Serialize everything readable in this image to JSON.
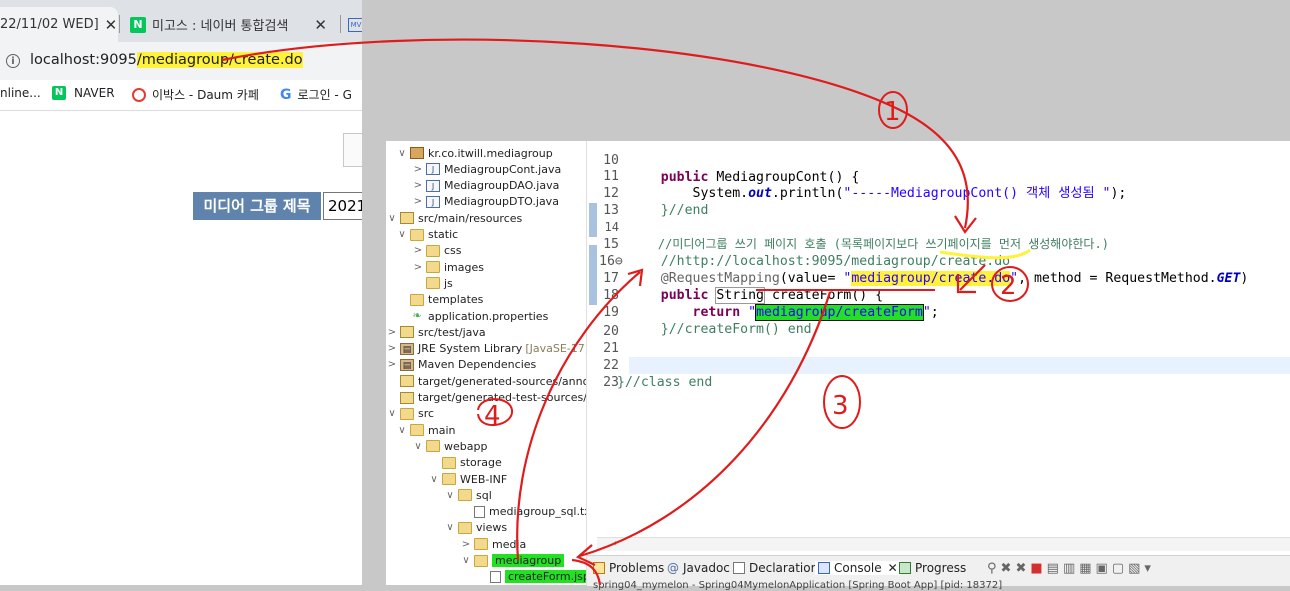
{
  "browser": {
    "tabs": [
      {
        "label": "22/11/02 WED] ",
        "close": "✕"
      },
      {
        "label": "미고스 : 네이버 통합검색",
        "close": "✕",
        "favicon": "N"
      },
      {
        "label": "MV",
        "favicon": "MV"
      }
    ],
    "url_host": "localhost:9095",
    "url_path": "/mediagroup/create.do",
    "bookmarks": [
      {
        "label": "nline..."
      },
      {
        "label": "NAVER",
        "icon": "N"
      },
      {
        "label": "이박스 - Daum 카페"
      },
      {
        "label": "로그인 - G",
        "icon": "G"
      }
    ],
    "form": {
      "title_label": "미디어 그룹 제목",
      "title_value": "2021"
    }
  },
  "explorer": {
    "items": [
      {
        "label": "kr.co.itwill.mediagroup",
        "twisty": "∨",
        "icon": "pkg"
      },
      {
        "label": "MediagroupCont.java",
        "twisty": ">",
        "icon": "java"
      },
      {
        "label": "MediagroupDAO.java",
        "twisty": ">",
        "icon": "java"
      },
      {
        "label": "MediagroupDTO.java",
        "twisty": ">",
        "icon": "java"
      },
      {
        "label": "src/main/resources",
        "twisty": "∨",
        "icon": "srcfolder"
      },
      {
        "label": "static",
        "twisty": "∨",
        "icon": "folder"
      },
      {
        "label": "css",
        "twisty": ">",
        "icon": "folder"
      },
      {
        "label": "images",
        "twisty": ">",
        "icon": "folder"
      },
      {
        "label": "js",
        "twisty": "",
        "icon": "folder"
      },
      {
        "label": "templates",
        "twisty": "",
        "icon": "folder"
      },
      {
        "label": "application.properties",
        "twisty": "",
        "icon": "leaf"
      },
      {
        "label": "src/test/java",
        "twisty": ">",
        "icon": "srcfolder"
      },
      {
        "label": "JRE System Library",
        "suffix": "[JavaSE-17]",
        "twisty": ">",
        "icon": "lib"
      },
      {
        "label": "Maven Dependencies",
        "twisty": ">",
        "icon": "lib"
      },
      {
        "label": "target/generated-sources/annotatio",
        "twisty": "",
        "icon": "srcfolder"
      },
      {
        "label": "target/generated-test-sources/test-a",
        "twisty": "",
        "icon": "srcfolder"
      },
      {
        "label": "src",
        "twisty": "∨",
        "icon": "folder"
      },
      {
        "label": "main",
        "twisty": "∨",
        "icon": "folder"
      },
      {
        "label": "webapp",
        "twisty": "∨",
        "icon": "folder"
      },
      {
        "label": "storage",
        "twisty": "",
        "icon": "folder"
      },
      {
        "label": "WEB-INF",
        "twisty": "∨",
        "icon": "folder"
      },
      {
        "label": "sql",
        "twisty": "∨",
        "icon": "folder"
      },
      {
        "label": "mediagroup_sql.txt",
        "twisty": "",
        "icon": "doc"
      },
      {
        "label": "views",
        "twisty": "∨",
        "icon": "folder"
      },
      {
        "label": "media",
        "twisty": ">",
        "icon": "folder"
      },
      {
        "label": "mediagroup",
        "twisty": "∨",
        "icon": "folder",
        "highlight": true
      },
      {
        "label": "createForm.jsp",
        "twisty": "",
        "icon": "doc",
        "highlight": true
      }
    ]
  },
  "editor": {
    "lines": [
      {
        "num": "10",
        "text": "    public MediagroupCont() {"
      },
      {
        "num": "11",
        "text": "        System.out.println(\"-----MediagroupCont() 객체 생성됨 \");"
      },
      {
        "num": "12",
        "text": "    }//end"
      },
      {
        "num": "13",
        "text": ""
      },
      {
        "num": "14",
        "text": "    //미디어그룹 쓰기 페이지 호출 (목록페이지보다 쓰기페이지를 먼저 생성해야한다.)"
      },
      {
        "num": "15",
        "text": "    //http://localhost:9095/mediagroup/create.do"
      },
      {
        "num": "16⊖",
        "text": "    @RequestMapping(value= \"mediagroup/create.do\", method = RequestMethod.GET)"
      },
      {
        "num": "17",
        "text": "    public String createForm() {"
      },
      {
        "num": "18",
        "text": "        return \"mediagroup/createForm\";"
      },
      {
        "num": "19",
        "text": "    }//createForm() end"
      },
      {
        "num": "20",
        "text": ""
      },
      {
        "num": "21",
        "text": ""
      },
      {
        "num": "22",
        "text": "}//class end"
      },
      {
        "num": "23",
        "text": ""
      }
    ],
    "tokens": {
      "public": "public",
      "ctor_rest": " MediagroupCont() {",
      "system": "        System.",
      "out": "out",
      "println": ".println(",
      "println_str": "\"-----MediagroupCont() 객체 생성됨 \"",
      "println_end": ");",
      "end12": "    }//end",
      "c14": "    //미디어그룹 쓰기 페이지 호출 (목록페이지보다 쓰기페이지를 먼저 생성해야한다.)",
      "c15": "    //http://localhost:9095/mediagroup/create.do",
      "rm": "@RequestMapping",
      "rm_mid": "(value= ",
      "rm_q": "\"",
      "rm_val": "mediagroup/create.do",
      "rm_rest": ", method = RequestMethod.",
      "get": "GET",
      "rm_close": ")",
      "string": "String",
      "cf": " createForm() {",
      "ret": "return",
      "ret_val": "mediagroup/createForm",
      "semi": ";",
      "end19": "    }//createForm() end",
      "class_end": "}//class end"
    }
  },
  "bottom": {
    "tabs": [
      "Problems",
      "Javadoc",
      "Declaration",
      "Console",
      "Progress"
    ],
    "console_text": "spring04_mymelon - Spring04MymelonApplication [Spring Boot App]  [pid: 18372]"
  },
  "annotations": [
    "1",
    "2",
    "3",
    "4"
  ],
  "colors": {
    "annotation": "#e01b1b",
    "highlight_yellow": "#fff23a",
    "highlight_green": "#22e022",
    "form_label_bg": "#5f83ad"
  }
}
